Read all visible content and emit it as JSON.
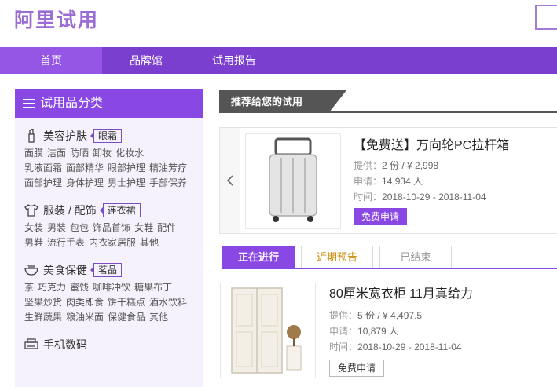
{
  "header": {
    "logo": "阿里试用"
  },
  "nav": [
    {
      "label": "首页"
    },
    {
      "label": "品牌馆"
    },
    {
      "label": "试用报告"
    }
  ],
  "sidebar": {
    "title": "试用品分类",
    "categories": [
      {
        "name": "美容护肤",
        "tag": "眼霜",
        "icon": "lipstick-icon",
        "links": [
          "面膜",
          "洁面",
          "防晒",
          "卸妆",
          "化妆水",
          "乳液面霜",
          "面部精华",
          "眼部护理",
          "精油芳疗",
          "面部护理",
          "身体护理",
          "男士护理",
          "手部保养"
        ]
      },
      {
        "name": "服装 / 配饰",
        "tag": "连衣裙",
        "icon": "shirt-icon",
        "links": [
          "女装",
          "男装",
          "包包",
          "饰品首饰",
          "女鞋",
          "配件",
          "男鞋",
          "流行手表",
          "内衣家居服",
          "其他"
        ]
      },
      {
        "name": "美食保健",
        "tag": "茗品",
        "icon": "bowl-icon",
        "links": [
          "茶",
          "巧克力",
          "蜜饯",
          "咖啡冲饮",
          "糖果布丁",
          "坚果炒货",
          "肉类即食",
          "饼干糕点",
          "酒水饮料",
          "生鲜蔬果",
          "粮油米面",
          "保健食品",
          "其他"
        ]
      },
      {
        "name": "手机数码",
        "icon": "printer-icon",
        "links": []
      }
    ]
  },
  "recommend": {
    "label": "推荐给您的试用"
  },
  "featured": {
    "title": "【免费送】万向轮PC拉杆箱",
    "supply_label": "提供：",
    "supply_count": "2 份 / ",
    "price": "¥ 2,998",
    "apply_label": "申请：",
    "apply_count": "14,934 人",
    "time_label": "时间：",
    "time": "2018-10-29 - 2018-11-04",
    "button": "免费申请"
  },
  "tabs": [
    {
      "label": "正在进行"
    },
    {
      "label": "近期预告"
    },
    {
      "label": "已结束"
    }
  ],
  "product2": {
    "title": "80厘米宽衣柜 11月真给力",
    "supply_label": "提供：",
    "supply_count": "5 份 / ",
    "price": "¥ 4,497.5",
    "apply_label": "申请：",
    "apply_count": "10,879 人",
    "time_label": "时间：",
    "time": "2018-10-29 - 2018-11-04",
    "button": "免费申请"
  },
  "colors": {
    "brand": "#7b3fd0",
    "accent": "#8948e4",
    "logo": "#9b6bd6"
  }
}
